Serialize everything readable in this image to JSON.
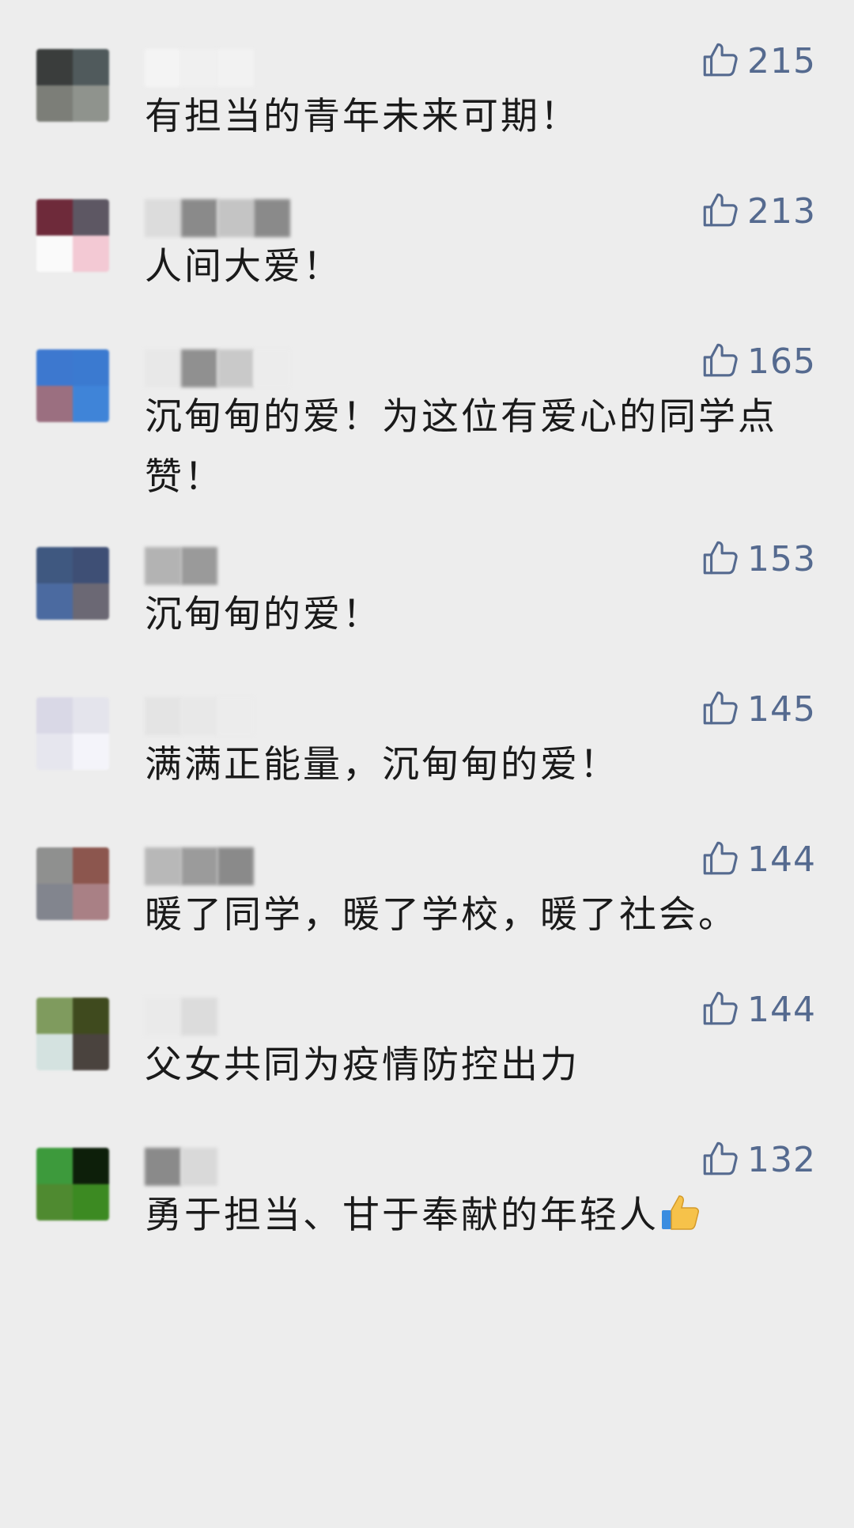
{
  "comments": [
    {
      "likes": "215",
      "text": "有担当的青年未来可期！",
      "avatar": [
        "#3a3d3c",
        "#505a5c",
        "#7c7e78",
        "#8f938d"
      ],
      "name": [
        "#f4f4f4",
        "#f0f0f0",
        "#f2f2f2"
      ]
    },
    {
      "likes": "213",
      "text": "人间大爱！",
      "avatar": [
        "#6e2a3a",
        "#5d5763",
        "#fafafa",
        "#f3c9d4"
      ],
      "name": [
        "#dcdcdc",
        "#8a8a8a",
        "#c4c4c4",
        "#8a8a8a"
      ]
    },
    {
      "likes": "165",
      "text": "沉甸甸的爱！为这位有爱心的同学点赞！",
      "avatar": [
        "#3d78cf",
        "#3b7ad0",
        "#9b6f80",
        "#3f84d8"
      ],
      "name": [
        "#e8e8e8",
        "#909090",
        "#c9c9c9",
        "#ececec"
      ]
    },
    {
      "likes": "153",
      "text": "沉甸甸的爱！",
      "avatar": [
        "#3f5880",
        "#3e4f75",
        "#4b6aa0",
        "#6b6874"
      ],
      "name": [
        "#b3b3b3",
        "#9a9a9a"
      ]
    },
    {
      "likes": "145",
      "text": "满满正能量，沉甸甸的爱！",
      "avatar": [
        "#d9d8e6",
        "#e4e4ec",
        "#e6e6ee",
        "#f4f4fa"
      ],
      "name": [
        "#e4e4e4",
        "#e8e8e8",
        "#ececec"
      ]
    },
    {
      "likes": "144",
      "text": "暖了同学，暖了学校，暖了社会。",
      "avatar": [
        "#8f908f",
        "#8c564e",
        "#82858e",
        "#a98085"
      ],
      "name": [
        "#b8b8b8",
        "#9b9b9b",
        "#8a8a8a"
      ]
    },
    {
      "likes": "144",
      "text": "父女共同为疫情防控出力",
      "avatar": [
        "#7f9b5e",
        "#3f4a1e",
        "#d4e2e0",
        "#4a433e"
      ],
      "name": [
        "#eaeaea",
        "#dcdcdc"
      ]
    },
    {
      "likes": "132",
      "text": "勇于担当、甘于奉献的年轻人",
      "avatar": [
        "#3d9a3c",
        "#0d1f0a",
        "#4f8a30",
        "#3c8a22"
      ],
      "name": [
        "#8a8a8a",
        "#d9d9d9"
      ]
    }
  ],
  "colors": {
    "background": "#ededed",
    "like": "#556a8f",
    "text": "#1a1a1a"
  },
  "icons": {
    "like": "thumbs-up-outline-icon",
    "emoji": "thumbs-up-emoji-icon"
  }
}
